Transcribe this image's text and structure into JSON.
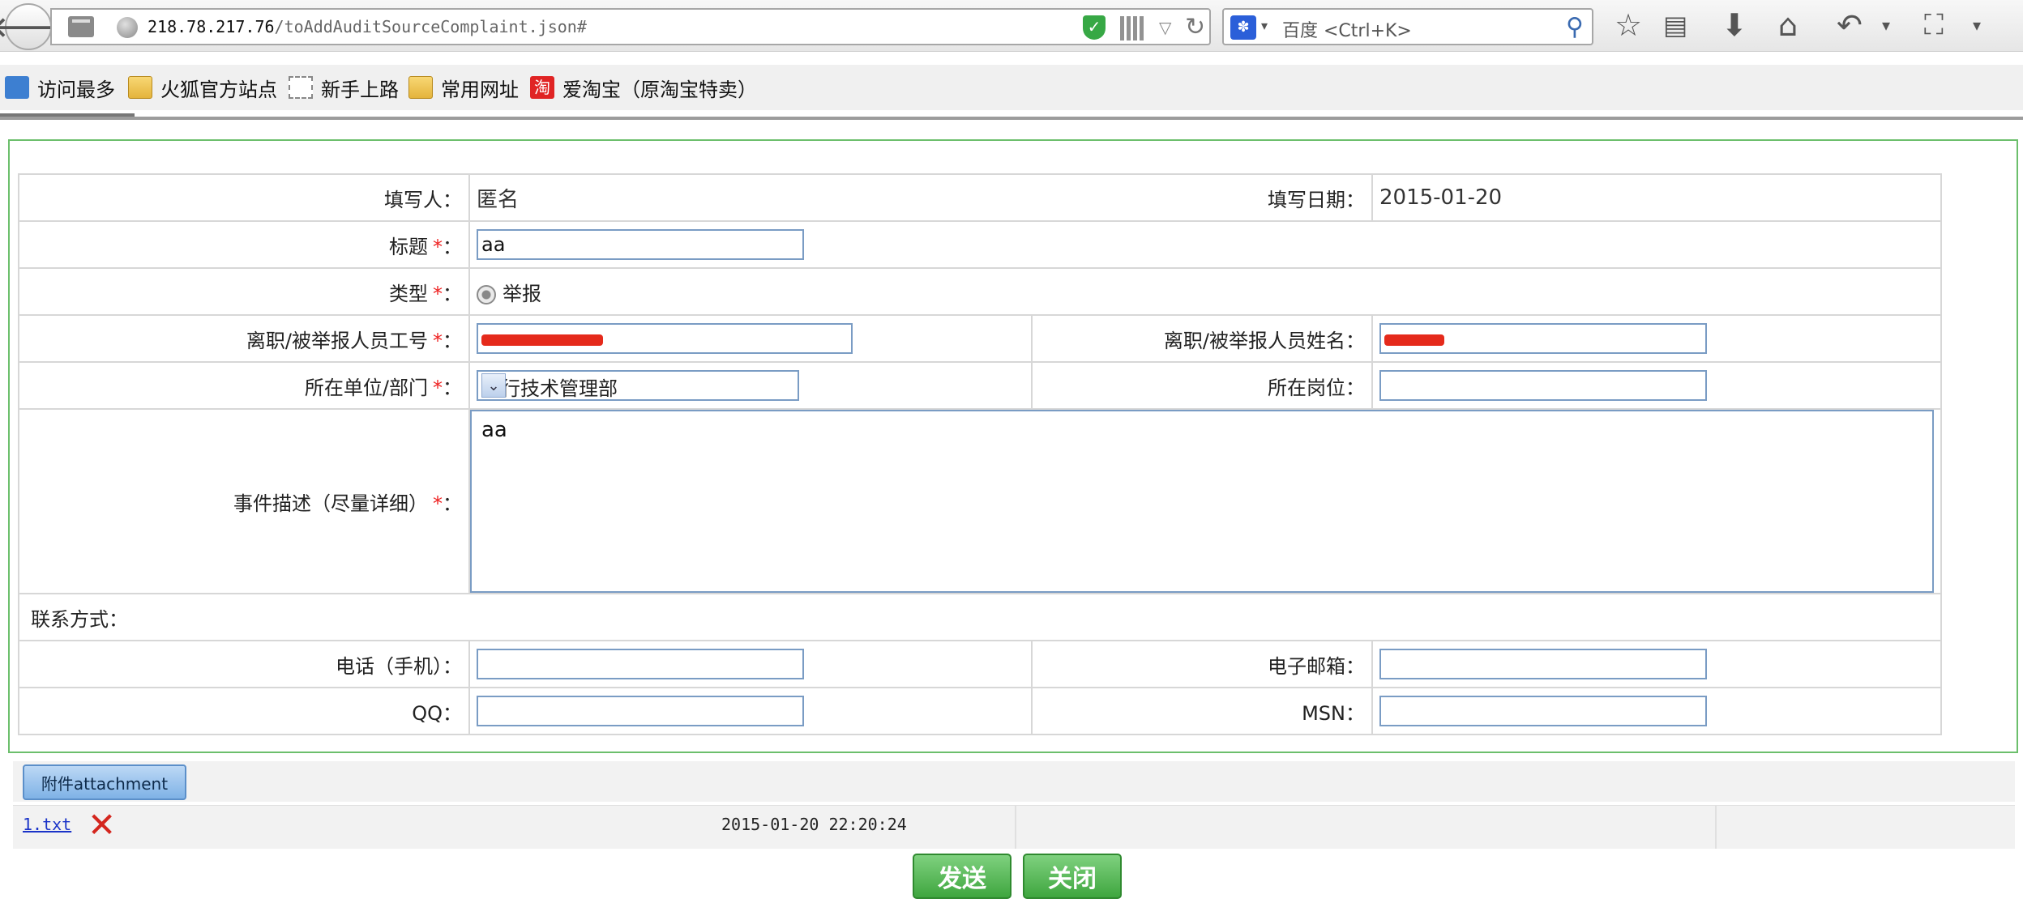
{
  "browser": {
    "url_host": "218.78.217.76",
    "url_path": "/toAddAuditSourceComplaint.json#",
    "search_placeholder": "百度 <Ctrl+K>",
    "bookmarks": [
      "访问最多",
      "火狐官方站点",
      "新手上路",
      "常用网址",
      "爱淘宝（原淘宝特卖）"
    ],
    "taobao_glyph": "淘"
  },
  "form": {
    "filler_label": "填写人：",
    "filler_value": "匿名",
    "date_label": "填写日期：",
    "date_value": "2015-01-20",
    "title_label": "标题",
    "title_value": "aa",
    "type_label": "类型",
    "type_option": "举报",
    "empid_label": "离职/被举报人员工号",
    "name_label": "离职/被举报人员姓名：",
    "dept_label": "所在单位/部门",
    "dept_value": "飞行技术管理部",
    "post_label": "所在岗位：",
    "desc_label": "事件描述（尽量详细）",
    "desc_value": "aa",
    "contact_label": "联系方式：",
    "phone_label": "电话（手机）：",
    "email_label": "电子邮箱：",
    "qq_label": "QQ：",
    "msn_label": "MSN：",
    "required_mark": "*",
    "colon": "："
  },
  "attachments": {
    "tab_label": "附件attachment",
    "files": [
      {
        "name": "1.txt",
        "date": "2015-01-20 22:20:24"
      }
    ]
  },
  "buttons": {
    "send": "发送",
    "close": "关闭"
  }
}
